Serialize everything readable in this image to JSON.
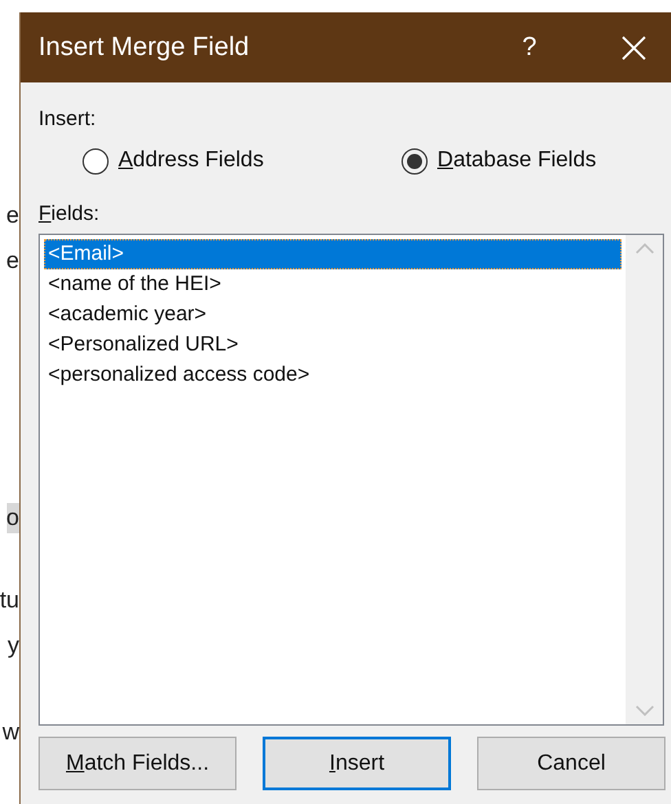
{
  "document": {
    "fragments": [
      "e",
      "e",
      "o",
      "tu",
      "y",
      "w"
    ]
  },
  "window": {
    "title": "Insert Merge Field",
    "help": "?"
  },
  "insert": {
    "label": "Insert:",
    "options": [
      {
        "label": "Address Fields",
        "mnemonic": true,
        "selected": false
      },
      {
        "label": "Database Fields",
        "mnemonic": true,
        "selected": true
      }
    ]
  },
  "fields": {
    "label": "Fields:",
    "mnemonic": true,
    "items": [
      {
        "label": "<Email>",
        "selected": true
      },
      {
        "label": "<name of the HEI>",
        "selected": false
      },
      {
        "label": "<academic year>",
        "selected": false
      },
      {
        "label": "<Personalized URL>",
        "selected": false
      },
      {
        "label": "<personalized access code>",
        "selected": false
      }
    ]
  },
  "buttons": [
    {
      "label": "Match Fields...",
      "mnemonic": true,
      "default": false
    },
    {
      "label": "Insert",
      "mnemonic": true,
      "default": true
    },
    {
      "label": "Cancel",
      "mnemonic": false,
      "default": false
    }
  ]
}
